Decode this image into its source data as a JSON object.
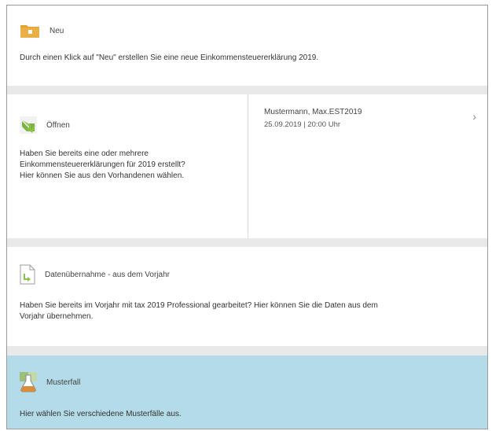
{
  "neu": {
    "title": "Neu",
    "description": "Durch einen Klick auf \"Neu\" erstellen Sie eine neue Einkommensteuererklärung 2019.",
    "icon": "new-folder-icon"
  },
  "oeffnen": {
    "title": "Öffnen",
    "description_lines": [
      "Haben Sie bereits eine oder mehrere",
      "Einkommensteuererklärungen für 2019 erstellt?",
      "Hier können Sie aus den Vorhandenen wählen."
    ],
    "icon": "open-arrow-icon",
    "recent": {
      "name": "Mustermann, Max.EST2019",
      "date": "25.09.2019 | 20:00 Uhr"
    }
  },
  "datenuebernahme": {
    "title": "Datenübernahme - aus dem Vorjahr",
    "description_lines": [
      "Haben Sie bereits im Vorjahr mit tax 2019 Professional gearbeitet? Hier können Sie die Daten aus dem",
      "Vorjahr übernehmen."
    ],
    "icon": "document-import-icon"
  },
  "musterfall": {
    "title": "Musterfall",
    "description": "Hier wählen Sie verschiedene Musterfälle aus.",
    "icon": "flask-icon"
  },
  "colors": {
    "folder": "#e4a432",
    "arrow": "#8bc34a",
    "highlight": "#b4dbe8",
    "separator": "#e9e9e9"
  }
}
